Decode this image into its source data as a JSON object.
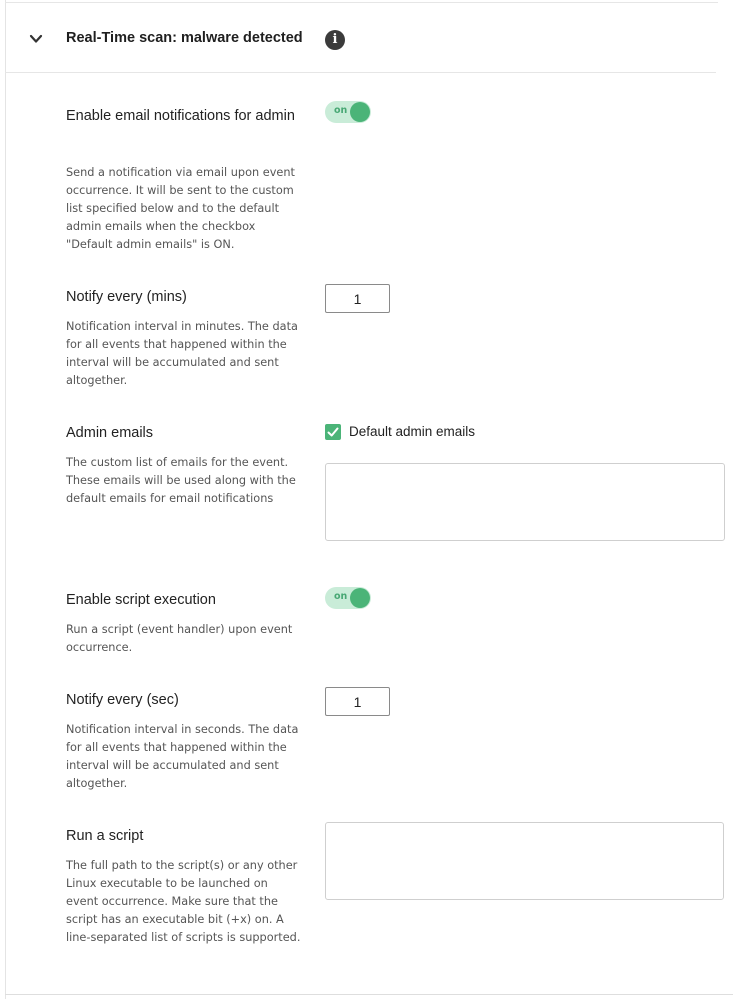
{
  "section": {
    "title": "Real-Time scan: malware detected",
    "info_icon": "i",
    "chevron_icon": "chevron-down-icon"
  },
  "email_notifications": {
    "label": "Enable email notifications for admin",
    "description": "Send a notification via email upon event occurrence. It will be sent to the custom list specified below and to the default admin emails when the checkbox \"Default admin emails\" is ON.",
    "toggle_text": "on",
    "enabled": true
  },
  "notify_mins": {
    "label": "Notify every (mins)",
    "value": "1",
    "description": "Notification interval in minutes. The data for all events that happened within the interval will be accumulated and sent altogether."
  },
  "admin_emails": {
    "label": "Admin emails",
    "description": "The custom list of emails for the event. These emails will be used along with the default emails for email notifications",
    "checkbox_label": "Default admin emails",
    "checkbox_checked": true,
    "value": ""
  },
  "script_execution": {
    "label": "Enable script execution",
    "description": "Run a script (event handler) upon event occurrence.",
    "toggle_text": "on",
    "enabled": true
  },
  "notify_sec": {
    "label": "Notify every (sec)",
    "value": "1",
    "description": "Notification interval in seconds. The data for all events that happened within the interval will be accumulated and sent altogether."
  },
  "run_script": {
    "label": "Run a script",
    "description": "The full path to the script(s) or any other Linux executable to be launched on event occurrence. Make sure that the script has an executable bit (+x) on. A line-separated list of scripts is supported.",
    "value": ""
  },
  "colors": {
    "accent_green": "#4bb478",
    "toggle_track": "#c9ecd8",
    "info_icon_bg": "#3b3b3b"
  }
}
